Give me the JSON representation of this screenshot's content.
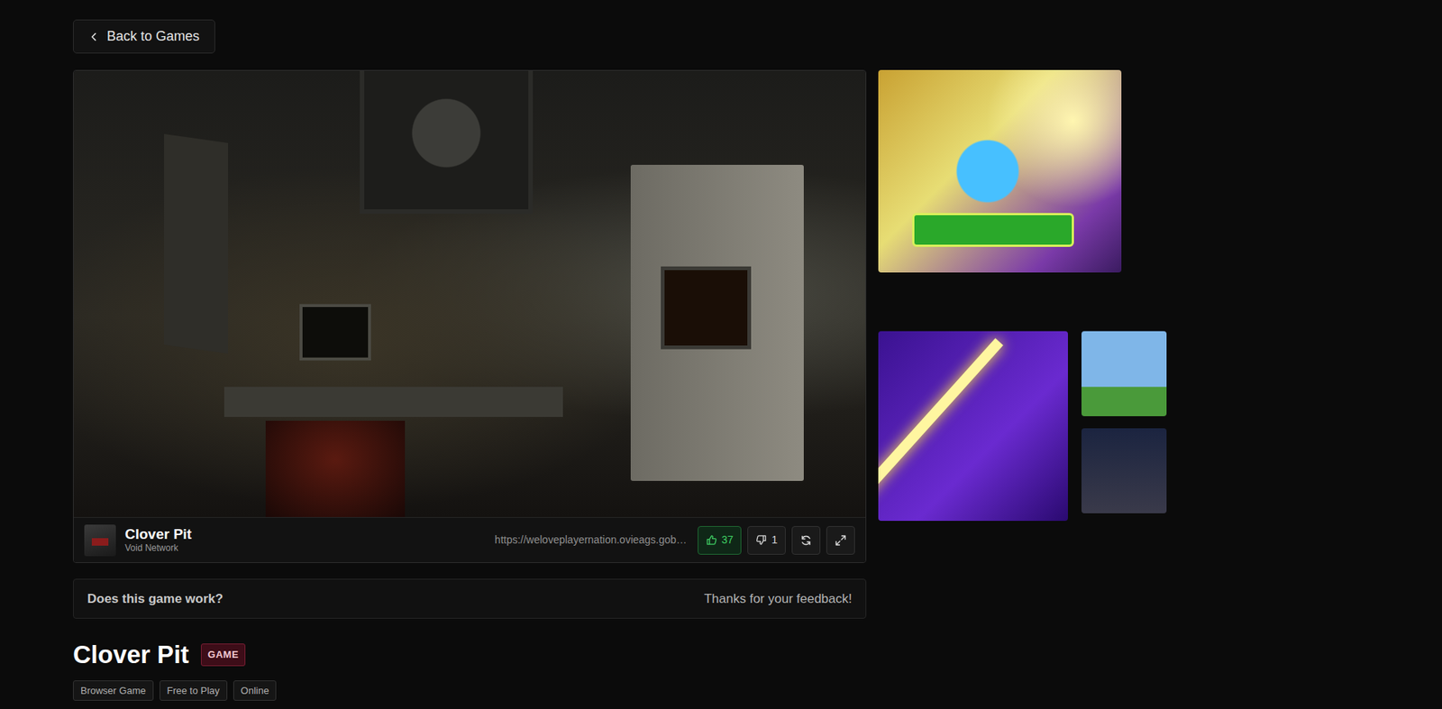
{
  "back_button": {
    "label": "Back to Games"
  },
  "player": {
    "title": "Clover Pit",
    "publisher": "Void Network",
    "url": "https://weloveplayernation.ovieags.gob…",
    "likes": "37",
    "liked": true,
    "dislikes": "1"
  },
  "feedback": {
    "question": "Does this game work?",
    "response": "Thanks for your feedback!"
  },
  "game": {
    "title": "Clover Pit",
    "badge": "GAME",
    "tags": [
      "Browser Game",
      "Free to Play",
      "Online"
    ]
  }
}
